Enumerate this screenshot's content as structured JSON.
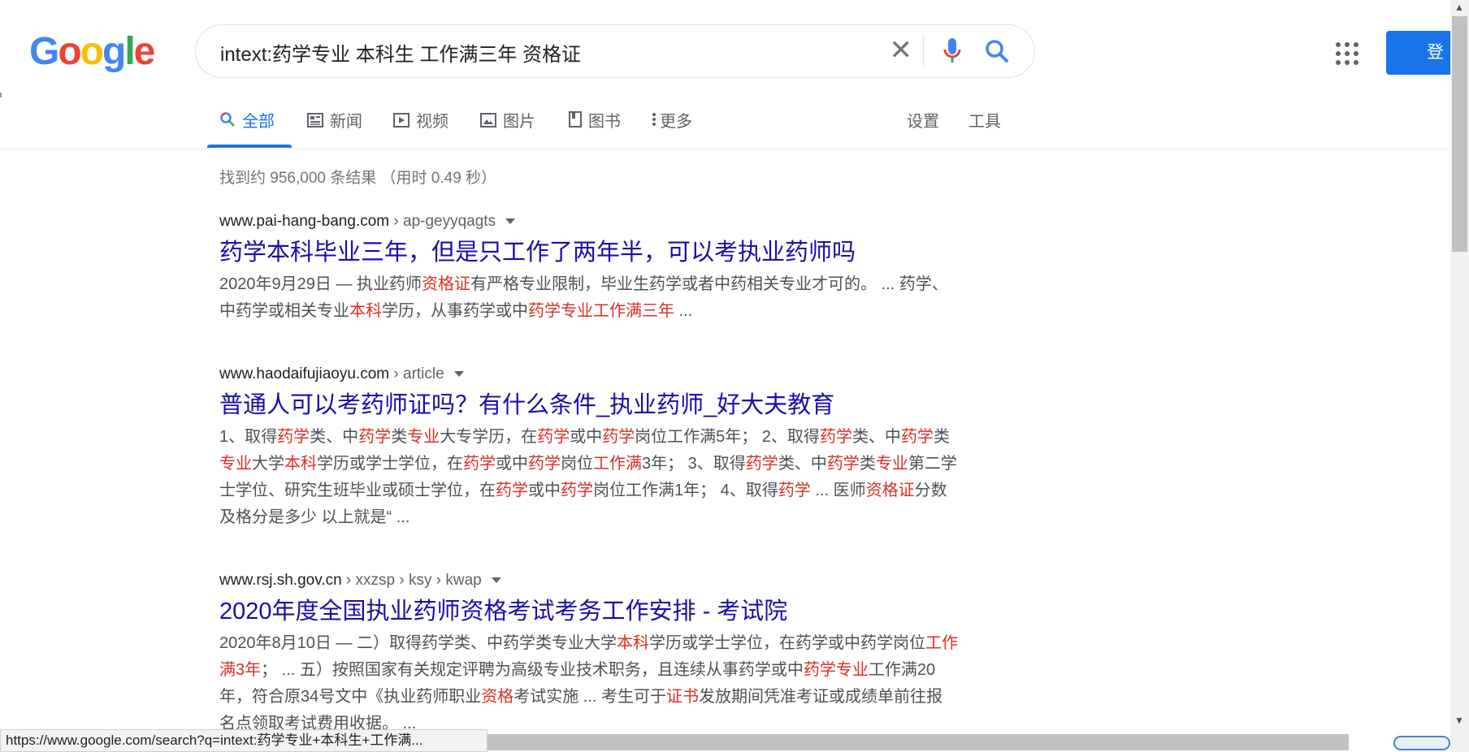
{
  "logo": {
    "letters": [
      "G",
      "o",
      "o",
      "g",
      "l",
      "e"
    ],
    "colors": [
      "#4285F4",
      "#EA4335",
      "#FBBC05",
      "#4285F4",
      "#34A853",
      "#EA4335"
    ]
  },
  "search": {
    "query": "intext:药学专业 本科生 工作满三年 资格证"
  },
  "header": {
    "signin_label": "登录"
  },
  "tabs": [
    {
      "label": "全部",
      "icon": "search-icon",
      "active": true
    },
    {
      "label": "新闻",
      "icon": "news-icon"
    },
    {
      "label": "视频",
      "icon": "video-icon"
    },
    {
      "label": "图片",
      "icon": "image-icon"
    },
    {
      "label": "图书",
      "icon": "book-icon"
    },
    {
      "label": "更多",
      "icon": "more-vert-icon"
    }
  ],
  "tools": {
    "settings": "设置",
    "tools": "工具"
  },
  "stats": "找到约 956,000 条结果 （用时 0.49 秒）",
  "results": [
    {
      "domain": "www.pai-hang-bang.com",
      "path": " › ap-geyyqagts",
      "title": "药学本科毕业三年，但是只工作了两年半，可以考执业药师吗",
      "snippet": [
        {
          "t": "2020年9月29日 — 执业药师"
        },
        {
          "t": "资格证",
          "em": true
        },
        {
          "t": "有严格专业限制，毕业生药学或者中药相关专业才可的。 ... 药学、中药学或相关专业"
        },
        {
          "t": "本科",
          "em": true
        },
        {
          "t": "学历，从事药学或中"
        },
        {
          "t": "药学专业工作满三年",
          "em": true
        },
        {
          "t": " ..."
        }
      ]
    },
    {
      "domain": "www.haodaifujiaoyu.com",
      "path": " › article",
      "title": "普通人可以考药师证吗？有什么条件_执业药师_好大夫教育",
      "snippet": [
        {
          "t": "1、取得"
        },
        {
          "t": "药学",
          "em": true
        },
        {
          "t": "类、中"
        },
        {
          "t": "药学",
          "em": true
        },
        {
          "t": "类"
        },
        {
          "t": "专业",
          "em": true
        },
        {
          "t": "大专学历，在"
        },
        {
          "t": "药学",
          "em": true
        },
        {
          "t": "或中"
        },
        {
          "t": "药学",
          "em": true
        },
        {
          "t": "岗位工作满5年； 2、取得"
        },
        {
          "t": "药学",
          "em": true
        },
        {
          "t": "类、中"
        },
        {
          "t": "药学",
          "em": true
        },
        {
          "t": "类"
        },
        {
          "t": "专业",
          "em": true
        },
        {
          "t": "大学"
        },
        {
          "t": "本科",
          "em": true
        },
        {
          "t": "学历或学士学位，在"
        },
        {
          "t": "药学",
          "em": true
        },
        {
          "t": "或中"
        },
        {
          "t": "药学",
          "em": true
        },
        {
          "t": "岗位"
        },
        {
          "t": "工作满",
          "em": true
        },
        {
          "t": "3年； 3、取得"
        },
        {
          "t": "药学",
          "em": true
        },
        {
          "t": "类、中"
        },
        {
          "t": "药学",
          "em": true
        },
        {
          "t": "类"
        },
        {
          "t": "专业",
          "em": true
        },
        {
          "t": "第二学士学位、研究生班毕业或硕士学位，在"
        },
        {
          "t": "药学",
          "em": true
        },
        {
          "t": "或中"
        },
        {
          "t": "药学",
          "em": true
        },
        {
          "t": "岗位工作满1年； 4、取得"
        },
        {
          "t": "药学",
          "em": true
        },
        {
          "t": " ... 医师"
        },
        {
          "t": "资格证",
          "em": true
        },
        {
          "t": "分数及格分是多少 以上就是“ ..."
        }
      ]
    },
    {
      "domain": "www.rsj.sh.gov.cn",
      "path": " › xxzsp › ksy › kwap",
      "title": "2020年度全国执业药师资格考试考务工作安排 - 考试院",
      "snippet": [
        {
          "t": "2020年8月10日 — 二）取得药学类、中药学类专业大学"
        },
        {
          "t": "本科",
          "em": true
        },
        {
          "t": "学历或学士学位，在药学或中药学岗位"
        },
        {
          "t": "工作满3年",
          "em": true
        },
        {
          "t": "； ... 五）按照国家有关规定评聘为高级专业技术职务，且连续从事药学或中"
        },
        {
          "t": "药学专业",
          "em": true
        },
        {
          "t": "工作满20年，符合原34号文中《执业药师职业"
        },
        {
          "t": "资格",
          "em": true
        },
        {
          "t": "考试实施 ... 考生可于"
        },
        {
          "t": "证书",
          "em": true
        },
        {
          "t": "发放期间凭准考证或成绩单前往报名点领取考试费用收据。 ..."
        }
      ]
    }
  ],
  "statusbar": {
    "url": "https://www.google.com/search?q=intext:药学专业+本科生+工作满..."
  }
}
